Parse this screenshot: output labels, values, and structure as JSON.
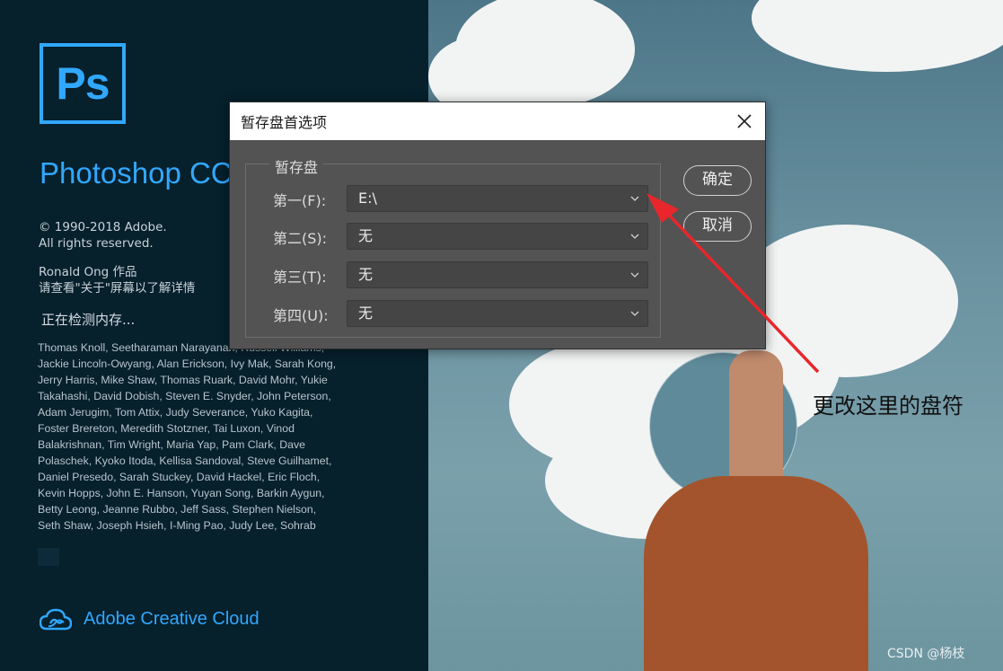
{
  "splash": {
    "logo_text": "Ps",
    "product_name": "Photoshop CC",
    "copyright_line1": "© 1990-2018 Adobe.",
    "copyright_line2": "All rights reserved.",
    "author_line1": "Ronald Ong 作品",
    "author_line2": "请查看\"关于\"屏幕以了解详情",
    "status": "正在检测内存...",
    "credits": "Thomas Knoll, Seetharaman Narayanan, Russell Williams,\nJackie Lincoln-Owyang, Alan Erickson, Ivy Mak, Sarah Kong,\nJerry Harris, Mike Shaw, Thomas Ruark, David Mohr, Yukie\nTakahashi, David Dobish, Steven E. Snyder, John Peterson,\nAdam Jerugim, Tom Attix, Judy Severance, Yuko Kagita,\nFoster Brereton, Meredith Stotzner, Tai Luxon, Vinod\nBalakrishnan, Tim Wright, Maria Yap, Pam Clark, Dave\nPolaschek, Kyoko Itoda, Kellisa Sandoval, Steve Guilhamet,\nDaniel Presedo, Sarah Stuckey, David Hackel, Eric Floch,\nKevin Hopps, John E. Hanson, Yuyan Song, Barkin Aygun,\nBetty Leong, Jeanne Rubbo, Jeff Sass, Stephen Nielson,\nSeth Shaw, Joseph Hsieh, I-Ming Pao, Judy Lee, Sohrab",
    "cc_label": "Adobe Creative Cloud",
    "brand_color": "#31a8ff"
  },
  "dialog": {
    "title": "暂存盘首选项",
    "group_label": "暂存盘",
    "rows": [
      {
        "label": "第一(F):",
        "value": "E:\\"
      },
      {
        "label": "第二(S):",
        "value": "无"
      },
      {
        "label": "第三(T):",
        "value": "无"
      },
      {
        "label": "第四(U):",
        "value": "无"
      }
    ],
    "ok_label": "确定",
    "cancel_label": "取消"
  },
  "annotation": {
    "text": "更改这里的盘符",
    "arrow_color": "#e8262b"
  },
  "watermark": "CSDN @杨枝"
}
